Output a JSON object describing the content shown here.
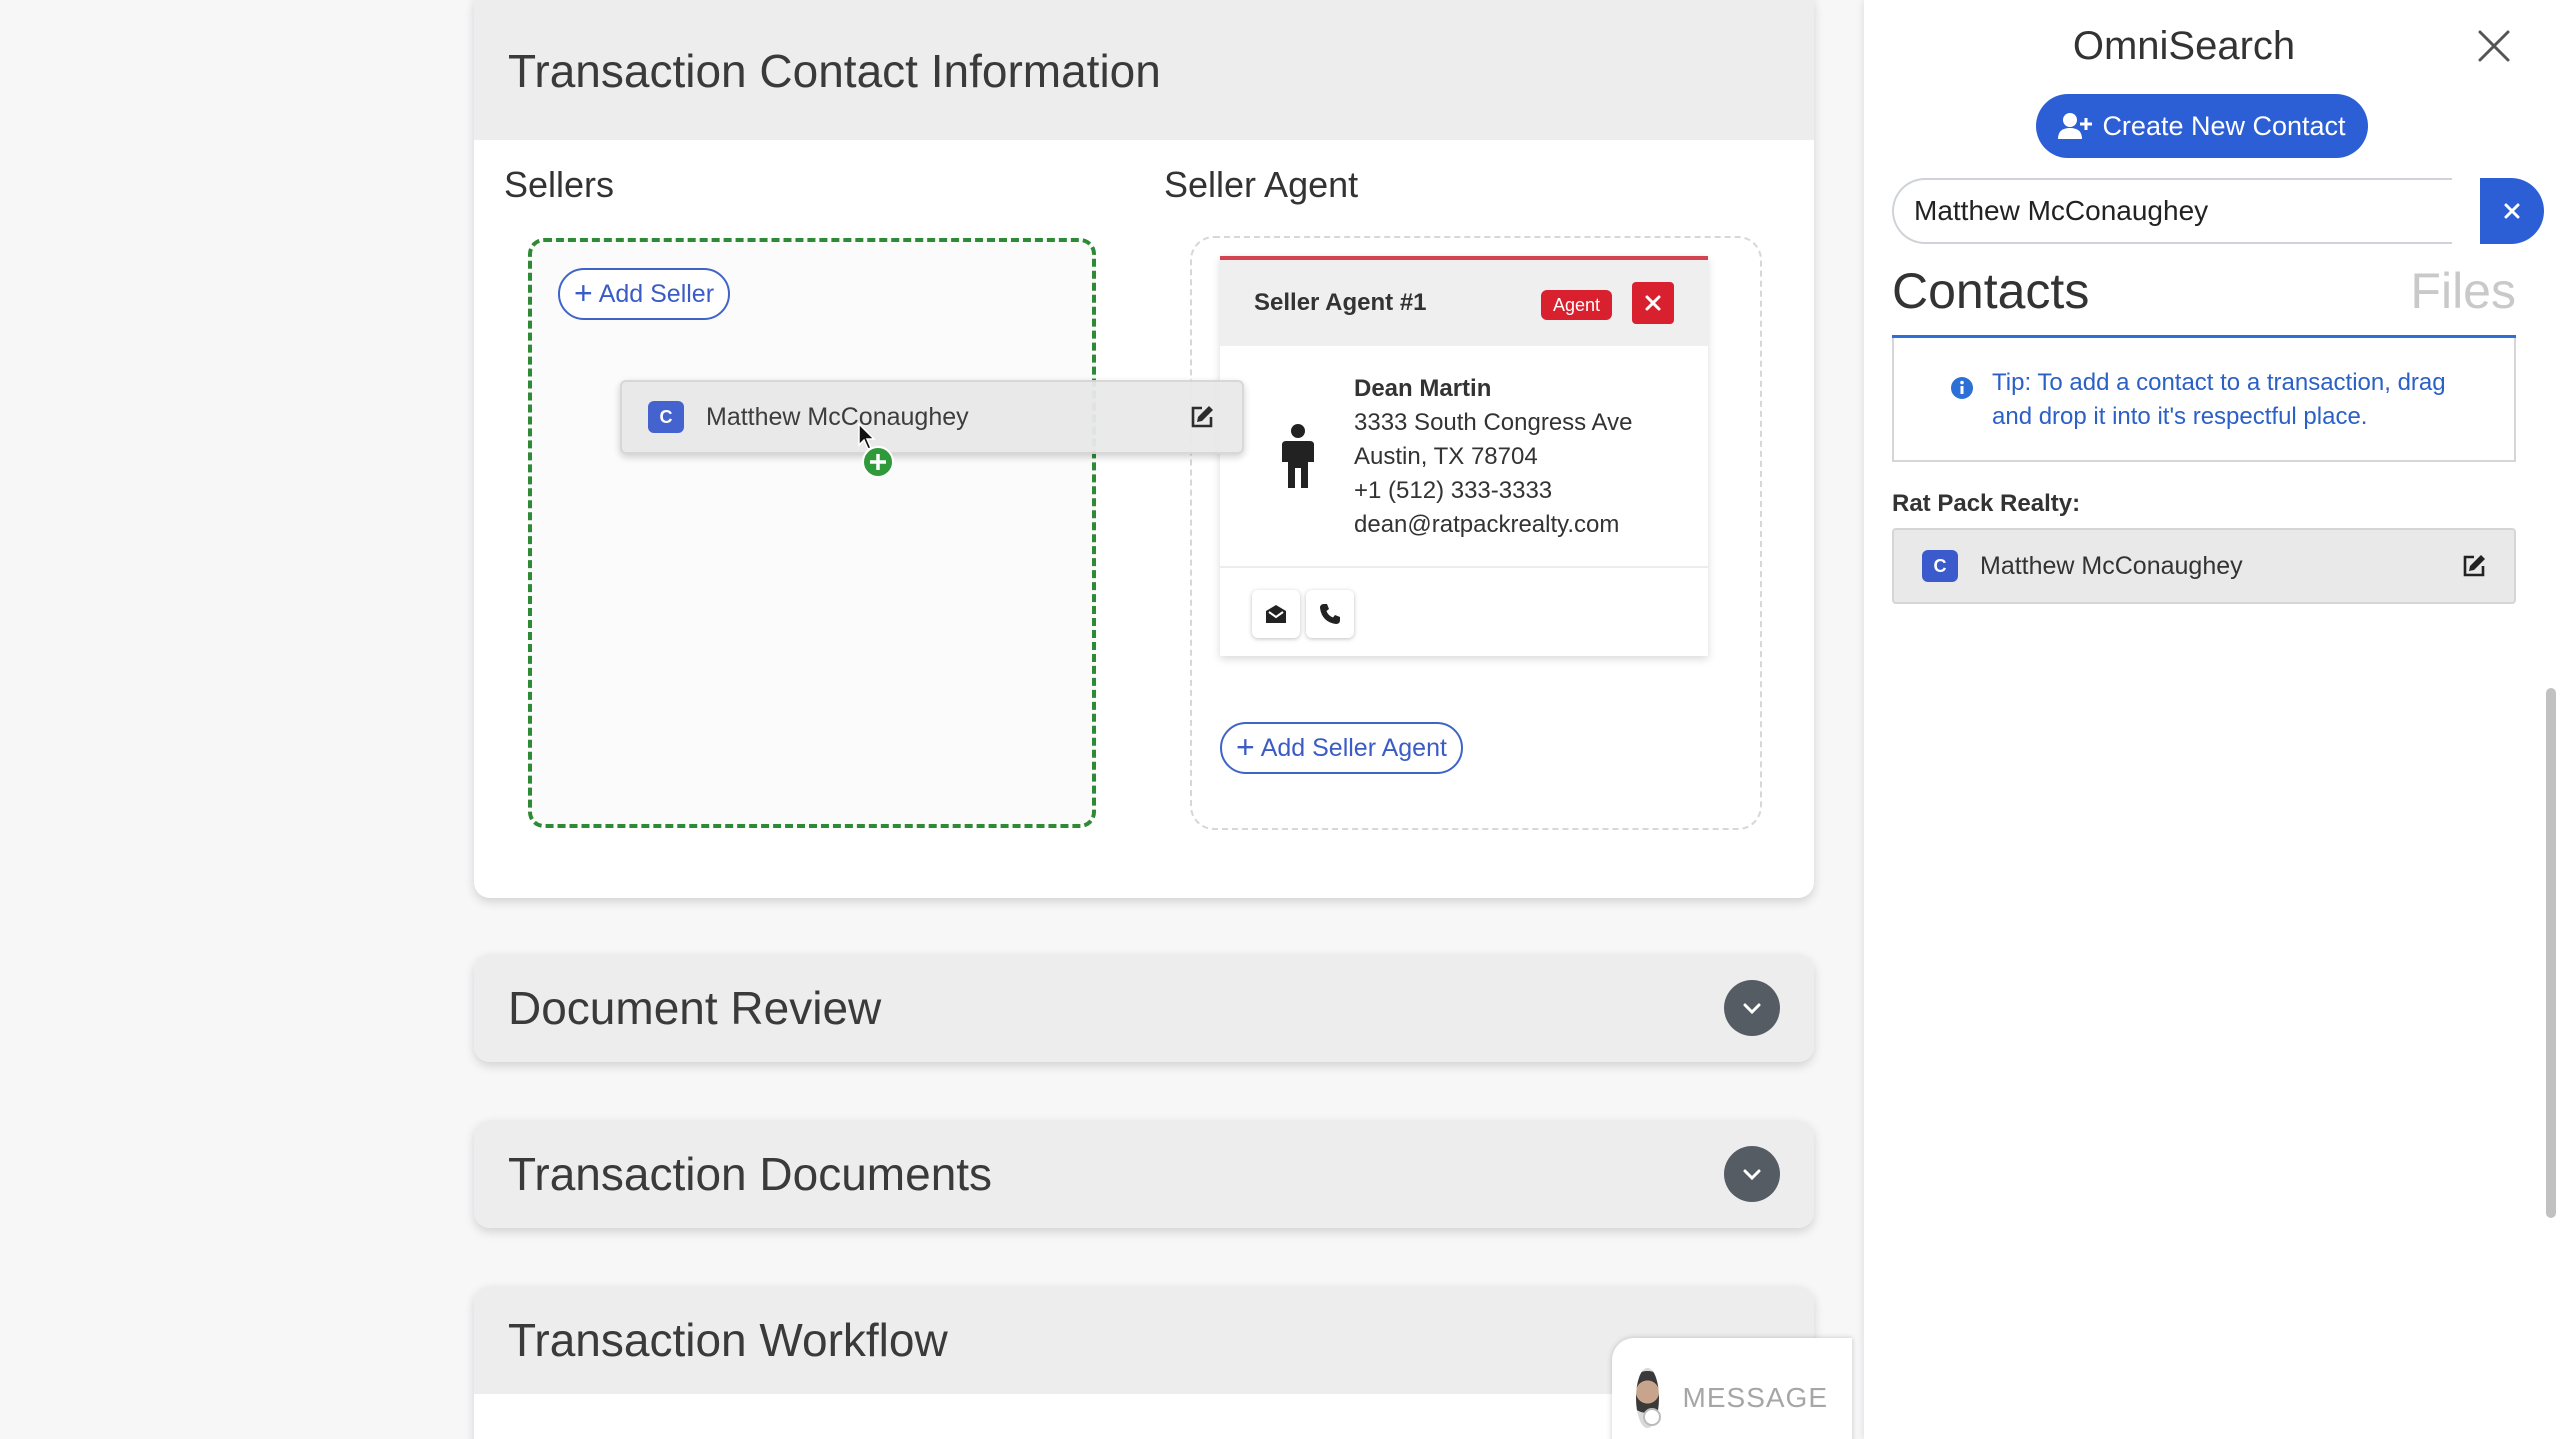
{
  "main": {
    "contact_section": {
      "title": "Transaction Contact Information",
      "sellers_label": "Sellers",
      "add_seller": "Add Seller",
      "seller_agent_label": "Seller Agent",
      "agent_card": {
        "title": "Seller Agent #1",
        "badge": "Agent",
        "name": "Dean Martin",
        "address1": "3333 South Congress Ave",
        "address2": "Austin, TX 78704",
        "phone": "+1 (512) 333-3333",
        "email": "dean@ratpackrealty.com"
      },
      "add_seller_agent": "Add Seller Agent",
      "dragged_contact": {
        "badge": "C",
        "name": "Matthew McConaughey"
      }
    },
    "sections": [
      {
        "title": "Document Review"
      },
      {
        "title": "Transaction Documents"
      },
      {
        "title": "Transaction Workflow"
      }
    ],
    "chat": {
      "placeholder": "MESSAGE"
    }
  },
  "omnisearch": {
    "title": "OmniSearch",
    "create_button": "Create New Contact",
    "search_value": "Matthew McConaughey",
    "tabs": {
      "contacts": "Contacts",
      "files": "Files"
    },
    "tip": "Tip: To add a contact to a transaction, drag and drop it into it's respectful place.",
    "group_label": "Rat Pack Realty:",
    "results": [
      {
        "badge": "C",
        "name": "Matthew McConaughey"
      }
    ]
  },
  "colors": {
    "accent_blue": "#2c5fd6",
    "drop_green": "#2f8a36",
    "agent_red": "#d8202f"
  },
  "icons": [
    "close-icon",
    "add-user-icon",
    "info-icon",
    "edit-icon",
    "person-icon",
    "email-icon",
    "phone-icon",
    "chevron-down-icon",
    "plus-icon"
  ]
}
